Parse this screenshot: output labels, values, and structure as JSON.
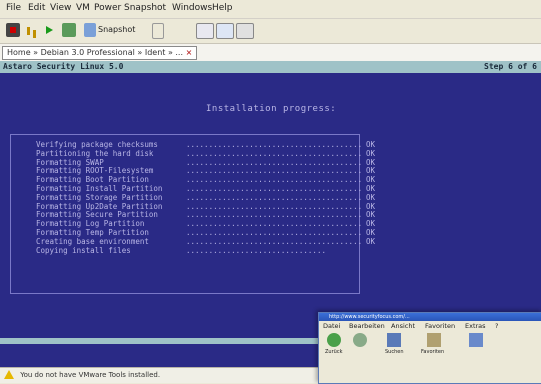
{
  "menubar": {
    "items": [
      "File",
      "Edit",
      "View",
      "VM",
      "Power",
      "Snapshot",
      "Windows",
      "Help"
    ]
  },
  "toolbar": {
    "snapshot_label": "Snapshot"
  },
  "tab": {
    "label": "Home » Debian 3.0 Professional » Ident » ..."
  },
  "vm": {
    "header_left": "Astaro Security Linux 5.0",
    "header_right": "Step 6 of 6",
    "heading": "Installation progress:",
    "steps": [
      {
        "label": "Verifying package checksums",
        "result": "OK"
      },
      {
        "label": "Partitioning the hard disk",
        "result": "OK"
      },
      {
        "label": "Formatting SWAP",
        "result": "OK"
      },
      {
        "label": "Formatting ROOT-Filesystem",
        "result": "OK"
      },
      {
        "label": "Formatting Boot Partition",
        "result": "OK"
      },
      {
        "label": "Formatting Install Partition",
        "result": "OK"
      },
      {
        "label": "Formatting Storage Partition",
        "result": "OK"
      },
      {
        "label": "Formatting Up2Date Partition",
        "result": "OK"
      },
      {
        "label": "Formatting Secure Partition",
        "result": "OK"
      },
      {
        "label": "Formatting Log Partition",
        "result": "OK"
      },
      {
        "label": "Formatting Temp Partition",
        "result": "OK"
      },
      {
        "label": "Creating base environment",
        "result": "OK"
      },
      {
        "label": "Copying install files",
        "result": ""
      }
    ]
  },
  "status": {
    "message": "You do not have VMware Tools installed."
  },
  "overlay": {
    "title": "http://www.securityfocus.com/...",
    "menus": [
      "Datei",
      "Bearbeiten",
      "Ansicht",
      "Favoriten",
      "Extras",
      "?"
    ],
    "buttons": [
      {
        "label": "Zurück"
      },
      {
        "label": "Suchen"
      },
      {
        "label": "Favoriten"
      }
    ]
  },
  "colors": {
    "console_bg": "#2a2a86",
    "console_text": "#b9b6e6",
    "header_bar": "#9fc2c7"
  }
}
